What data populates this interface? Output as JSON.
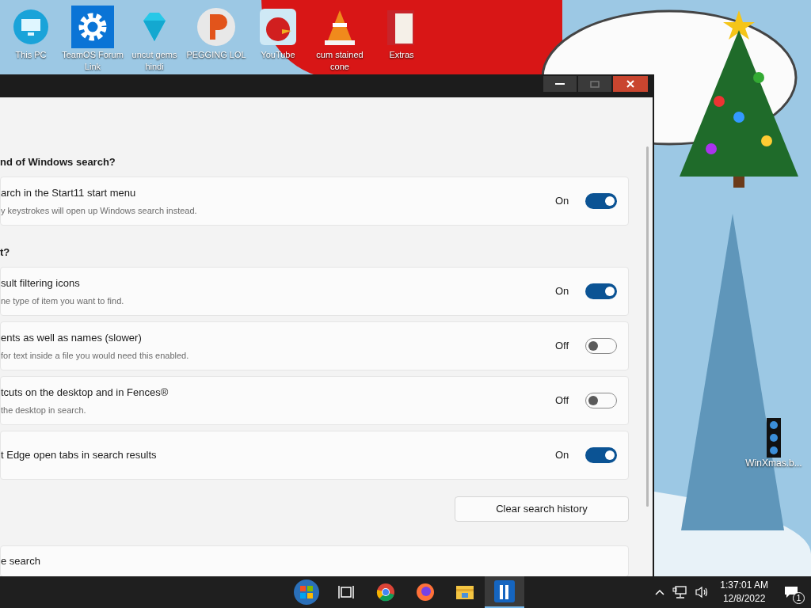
{
  "desktop_icons": [
    {
      "label": "This PC",
      "kind": "monitor"
    },
    {
      "label": "TeamOS Forum Link",
      "kind": "gear"
    },
    {
      "label": "uncut gems hindi",
      "kind": "gem"
    },
    {
      "label": "PEGGING LOL",
      "kind": "letter"
    },
    {
      "label": "YouTube",
      "kind": "bird"
    },
    {
      "label": "cum stained cone",
      "kind": "cone"
    },
    {
      "label": "Extras",
      "kind": "folder"
    }
  ],
  "side_icon": {
    "label": "WinXmas.b..."
  },
  "window": {
    "sections": [
      {
        "heading": "nd of Windows search?",
        "settings": [
          {
            "title": "arch in the Start11 start menu",
            "description": "y keystrokes will open up Windows search instead.",
            "state_label": "On",
            "on": true
          }
        ]
      },
      {
        "heading": "t?",
        "settings": [
          {
            "title": "sult filtering icons",
            "description": "ne type of item you want to find.",
            "state_label": "On",
            "on": true
          },
          {
            "title": "ents as well as names (slower)",
            "description": " for text inside a file you would need this enabled.",
            "state_label": "Off",
            "on": false
          },
          {
            "title": "tcuts on the desktop and in Fences®",
            "description": "the desktop in search.",
            "state_label": "Off",
            "on": false
          },
          {
            "title": "t Edge open tabs in search results",
            "state_label": "On",
            "on": true
          }
        ]
      }
    ],
    "button": "Clear search history",
    "partial_card": "e search"
  },
  "taskbar": {
    "apps": [
      {
        "kind": "start",
        "selected": false
      },
      {
        "kind": "taskview",
        "selected": false
      },
      {
        "kind": "chrome",
        "selected": false
      },
      {
        "kind": "firefox",
        "selected": false
      },
      {
        "kind": "explorer",
        "selected": false
      },
      {
        "kind": "start11",
        "selected": true
      }
    ],
    "time": "1:37:01 AM",
    "date": "12/8/2022",
    "notification_count": "1"
  }
}
